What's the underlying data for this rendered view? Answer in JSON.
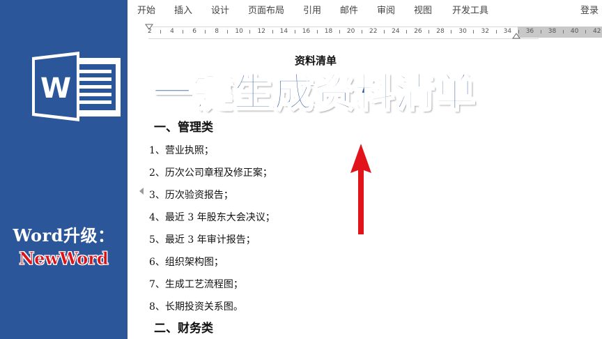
{
  "brand": {
    "icon_name": "word-icon",
    "logo_letter": "W",
    "promo_line1": "Word升级：",
    "promo_line2": "NewWord"
  },
  "ribbon": {
    "tabs": [
      "开始",
      "插入",
      "设计",
      "页面布局",
      "引用",
      "邮件",
      "审阅",
      "视图",
      "开发工具",
      "登录"
    ]
  },
  "ruler": {
    "numbers": [
      "2",
      "4",
      "6",
      "8",
      "10",
      "12",
      "14",
      "16",
      "18",
      "20",
      "22",
      "24",
      "26",
      "28",
      "30",
      "32",
      "34",
      "36",
      "38",
      "40",
      "42"
    ]
  },
  "document": {
    "title": "资料清单",
    "banner": "一键生成资料清单",
    "section1": "一、管理类",
    "items": [
      "1、营业执照；",
      "2、历次公司章程及修正案；",
      "3、历次验资报告；",
      "4、最近 3 年股东大会决议；",
      "5、最近 3 年审计报告；",
      "6、组织架构图；",
      "7、生成工艺流程图；",
      "8、长期投资关系图。"
    ],
    "section2": "二、财务类"
  },
  "colors": {
    "word_blue": "#2b579a",
    "arrow_red": "#e0141a"
  }
}
